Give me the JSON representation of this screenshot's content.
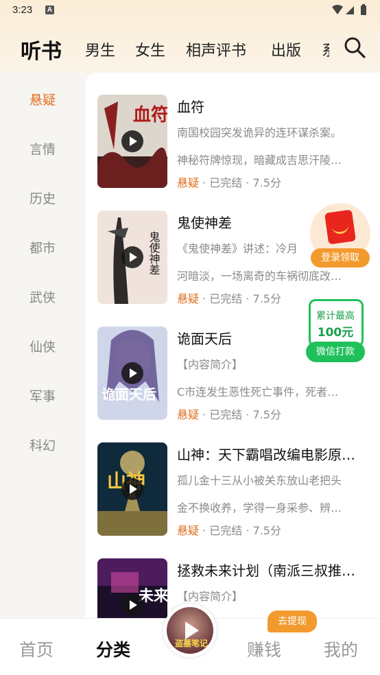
{
  "status_bar": {
    "time": "3:23",
    "notif_letter": "A"
  },
  "top_nav": {
    "tabs": [
      {
        "label": "听书",
        "active": true
      },
      {
        "label": "男生"
      },
      {
        "label": "女生"
      },
      {
        "label": "相声评书"
      },
      {
        "label": "出版"
      },
      {
        "label": "系"
      }
    ],
    "search_icon": "search-icon"
  },
  "sidebar": {
    "items": [
      {
        "label": "悬疑",
        "active": true
      },
      {
        "label": "言情"
      },
      {
        "label": "历史"
      },
      {
        "label": "都市"
      },
      {
        "label": "武侠"
      },
      {
        "label": "仙侠"
      },
      {
        "label": "军事"
      },
      {
        "label": "科幻"
      }
    ]
  },
  "books": [
    {
      "title": "血符",
      "desc1": "南国校园突发诡异的连环谋杀案。",
      "desc2": "神秘符牌惊现，暗藏成吉思汗陵…",
      "genre": "悬疑",
      "status": "· 已完结 · 7.5分",
      "cover_text": "血符",
      "cover_sub": "千寻\n出品"
    },
    {
      "title": "鬼使神差",
      "desc1": "《鬼使神差》讲述：冷月",
      "desc2": "河暗淡，一场离奇的车祸彻底改…",
      "genre": "悬疑",
      "status": "· 已完结 · 7.5分",
      "cover_text": "鬼使神差"
    },
    {
      "title": "诡面天后",
      "desc1": "【内容简介】",
      "desc2": "C市连发生恶性死亡事件，死者…",
      "genre": "悬疑",
      "status": "· 已完结 · 7.5分",
      "cover_text": "诡面天后"
    },
    {
      "title": "山神：天下霸唱改编电影原…",
      "desc1": "孤儿金十三从小被关东放山老把头",
      "desc2": "金不换收养，学得一身采参、辨…",
      "genre": "悬疑",
      "status": "· 已完结 · 7.5分",
      "cover_text": "山神"
    },
    {
      "title": "拯救未来计划（南派三叔推…",
      "desc1": "【内容简介】",
      "desc2": "",
      "genre": "",
      "status": "",
      "cover_text": "未来"
    }
  ],
  "promo": {
    "login_reward": "登录领取",
    "wx_line1": "累计最高",
    "wx_line2": "100元",
    "wx_button": "微信打款"
  },
  "bottom_bar": {
    "items": [
      {
        "label": "首页"
      },
      {
        "label": "分类",
        "active": true
      },
      {
        "label": "赚钱"
      },
      {
        "label": "我的"
      }
    ],
    "player_cover_text": "盗墓笔记",
    "withdraw_badge": "去提现"
  },
  "colors": {
    "accent": "#e06f1f",
    "promo_green": "#1fc05a",
    "promo_orange": "#f29a2e"
  }
}
